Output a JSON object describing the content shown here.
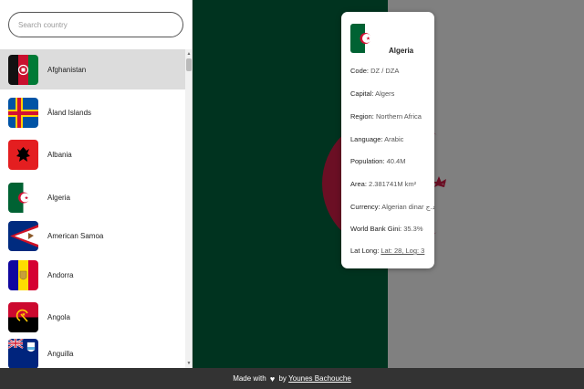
{
  "search": {
    "placeholder": "Search country"
  },
  "countries": [
    {
      "name": "Afghanistan",
      "selected": true
    },
    {
      "name": "Åland Islands",
      "selected": false
    },
    {
      "name": "Albania",
      "selected": false
    },
    {
      "name": "Algeria",
      "selected": false
    },
    {
      "name": "American Samoa",
      "selected": false
    },
    {
      "name": "Andorra",
      "selected": false
    },
    {
      "name": "Angola",
      "selected": false
    },
    {
      "name": "Anguilla",
      "selected": false
    }
  ],
  "card": {
    "title": "Algeria",
    "code_label": "Code:",
    "code_value": "DZ / DZA",
    "capital_label": "Capital:",
    "capital_value": "Algers",
    "region_label": "Region:",
    "region_value": "Northern Africa",
    "language_label": "Language:",
    "language_value": "Arabic",
    "population_label": "Population:",
    "population_value": "40.4M",
    "area_label": "Area:",
    "area_value": "2.381741M km²",
    "currency_label": "Currency:",
    "currency_value": "Algerian dinar د.ج",
    "gini_label": "World Bank Gini:",
    "gini_value": "35.3%",
    "latlong_label": "Lat Long:",
    "latlong_value": "Lat: 28, Log: 3"
  },
  "footer": {
    "made_with": "Made with",
    "heart": "♥",
    "by": "by",
    "author": "Younes Bachouche"
  },
  "colors": {
    "algeria_green": "#00331f",
    "algeria_white_area": "#808080",
    "algeria_red": "#6b0f24",
    "selected_bg": "#dcdcdc",
    "footer_bg": "#333333"
  },
  "icons": {
    "heart": "heart-icon",
    "scroll_up": "chevron-up-icon",
    "scroll_down": "chevron-down-icon"
  }
}
